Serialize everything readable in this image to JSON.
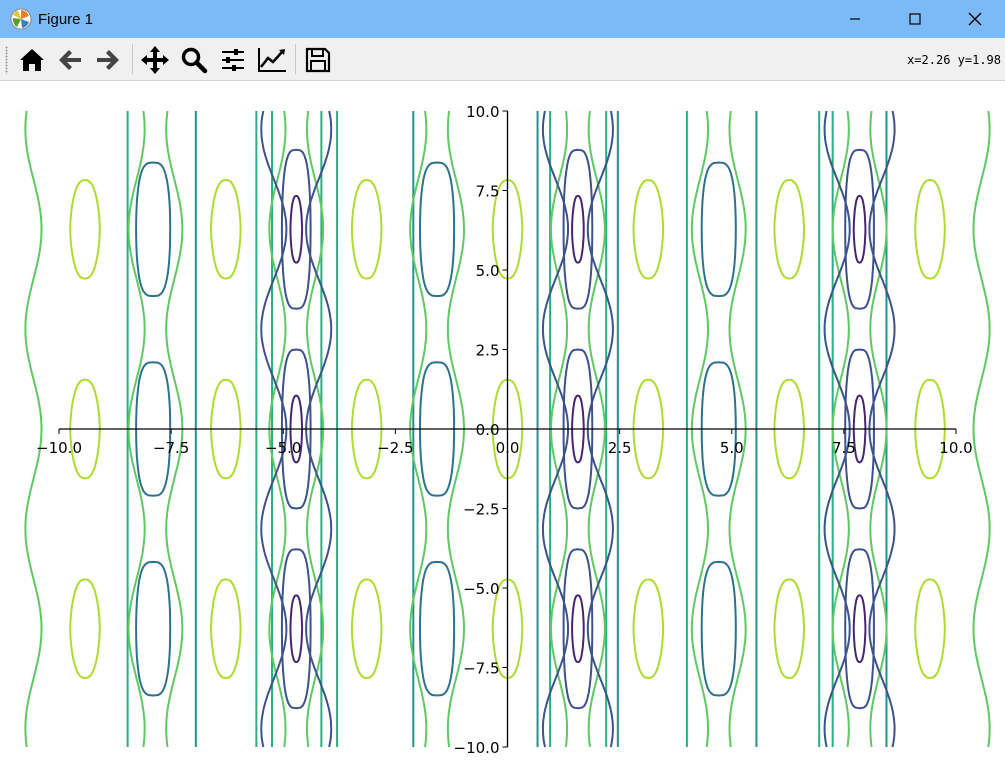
{
  "window": {
    "title": "Figure 1",
    "controls": [
      "minimize",
      "maximize",
      "close"
    ]
  },
  "toolbar": {
    "buttons": [
      {
        "name": "home",
        "icon": "home-icon"
      },
      {
        "name": "back",
        "icon": "arrow-left-icon"
      },
      {
        "name": "forward",
        "icon": "arrow-right-icon"
      },
      {
        "name": "pan",
        "icon": "move-icon"
      },
      {
        "name": "zoom",
        "icon": "magnifier-icon"
      },
      {
        "name": "subplots",
        "icon": "sliders-icon"
      },
      {
        "name": "customize",
        "icon": "line-chart-icon"
      },
      {
        "name": "save",
        "icon": "floppy-disk-icon"
      }
    ],
    "coords": "x=2.26 y=1.98"
  },
  "chart_data": {
    "type": "contour",
    "title": "",
    "xlabel": "",
    "ylabel": "",
    "xlim": [
      -10,
      10
    ],
    "ylim": [
      -10,
      10
    ],
    "spines": "centered",
    "grid": false,
    "xticks": [
      -10.0,
      -7.5,
      -5.0,
      -2.5,
      0.0,
      2.5,
      5.0,
      7.5,
      10.0
    ],
    "yticks": [
      -10.0,
      -7.5,
      -5.0,
      -2.5,
      0.0,
      2.5,
      5.0,
      7.5,
      10.0
    ],
    "xtick_labels": [
      "−10.0",
      "−7.5",
      "−5.0",
      "−2.5",
      "0.0",
      "2.5",
      "5.0",
      "7.5",
      "10.0"
    ],
    "ytick_labels": [
      "−10.0",
      "−7.5",
      "−5.0",
      "−2.5",
      "0.0",
      "2.5",
      "5.0",
      "7.5",
      "10.0"
    ],
    "colormap": "viridis",
    "level_colors": [
      "#482475",
      "#3b528b",
      "#2c728e",
      "#21918c",
      "#28ae80",
      "#5ec962",
      "#addc30"
    ],
    "pattern": {
      "x_period": 6.283,
      "y_period": 6.283,
      "column_types": [
        "blue",
        "teal",
        "green",
        "teal",
        "blue",
        "green",
        "teal",
        "blue",
        "green"
      ]
    }
  }
}
